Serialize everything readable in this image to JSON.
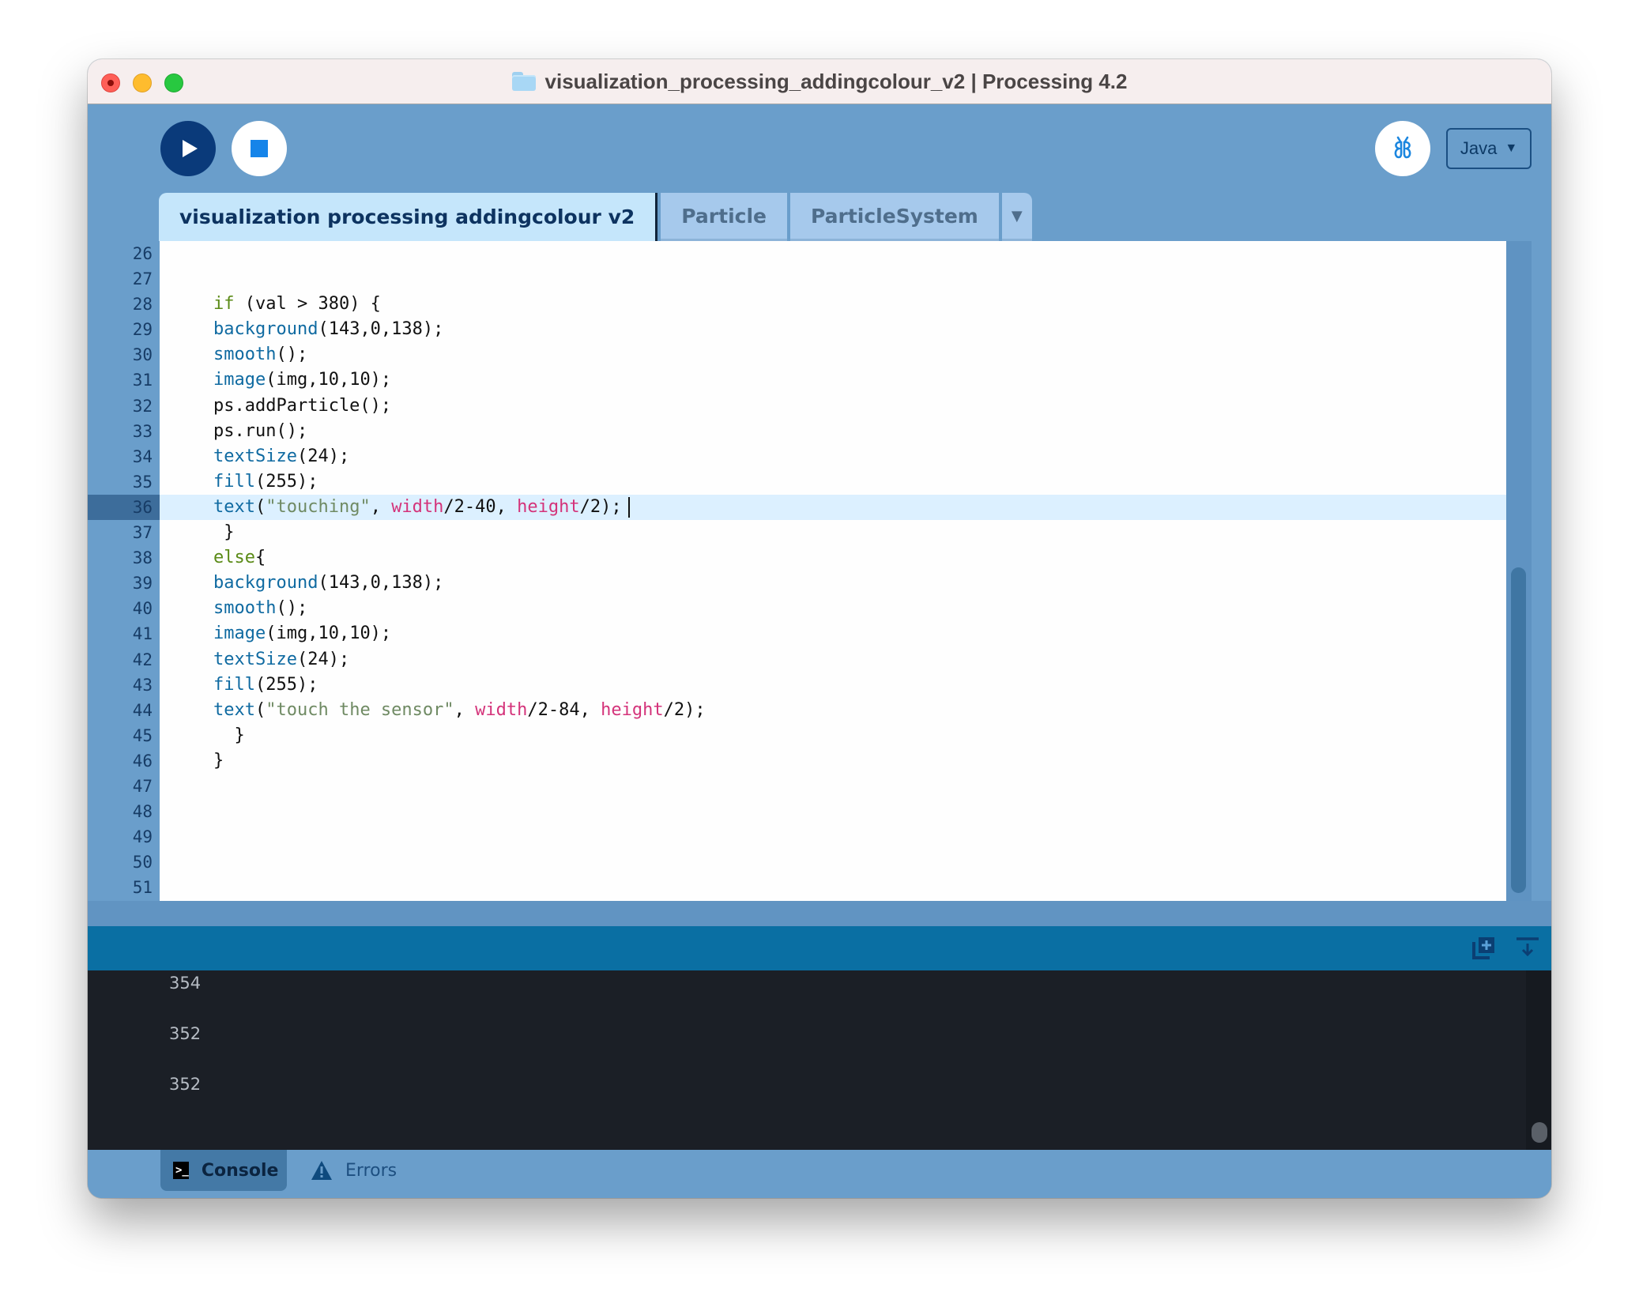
{
  "window": {
    "title": "visualization_processing_addingcolour_v2 | Processing 4.2"
  },
  "toolbar": {
    "run_label": "Run",
    "stop_label": "Stop",
    "debug_label": "Debug",
    "mode": "Java",
    "mode_caret": "▼"
  },
  "tabs": [
    {
      "label": "visualization processing addingcolour v2",
      "active": true
    },
    {
      "label": "Particle",
      "active": false
    },
    {
      "label": "ParticleSystem",
      "active": false
    }
  ],
  "tabs_menu": "▼",
  "editor": {
    "current_line": 36,
    "lines": [
      {
        "n": "26",
        "code": ""
      },
      {
        "n": "27",
        "code": ""
      },
      {
        "n": "28",
        "code": "if (val > 380) {"
      },
      {
        "n": "29",
        "code": "background(143,0,138);"
      },
      {
        "n": "30",
        "code": "smooth();"
      },
      {
        "n": "31",
        "code": "image(img,10,10);"
      },
      {
        "n": "32",
        "code": "ps.addParticle();"
      },
      {
        "n": "33",
        "code": "ps.run();"
      },
      {
        "n": "34",
        "code": "textSize(24);"
      },
      {
        "n": "35",
        "code": "fill(255);"
      },
      {
        "n": "36",
        "code": "text(\"touching\", width/2-40, height/2);"
      },
      {
        "n": "37",
        "code": " }"
      },
      {
        "n": "38",
        "code": "else{"
      },
      {
        "n": "39",
        "code": "background(143,0,138);"
      },
      {
        "n": "40",
        "code": "smooth();"
      },
      {
        "n": "41",
        "code": "image(img,10,10);"
      },
      {
        "n": "42",
        "code": "textSize(24);"
      },
      {
        "n": "43",
        "code": "fill(255);"
      },
      {
        "n": "44",
        "code": "text(\"touch the sensor\", width/2-84, height/2);"
      },
      {
        "n": "45",
        "code": "  }"
      },
      {
        "n": "46",
        "code": "}"
      },
      {
        "n": "47",
        "code": ""
      },
      {
        "n": "48",
        "code": ""
      },
      {
        "n": "49",
        "code": ""
      },
      {
        "n": "50",
        "code": ""
      },
      {
        "n": "51",
        "code": ""
      }
    ]
  },
  "console": {
    "lines": [
      "354",
      "352",
      "352"
    ]
  },
  "status": {
    "console_label": "Console",
    "errors_label": "Errors"
  },
  "colors": {
    "frame": "#6a9ecb",
    "run_button": "#0a3a7a",
    "stop_square": "#1584e9",
    "console_header": "#0a6fa3",
    "console_bg": "#1b1f26",
    "keyword": "#5a8a16",
    "function": "#0f6aa1",
    "string": "#6f8a63",
    "variable": "#d4337a"
  }
}
